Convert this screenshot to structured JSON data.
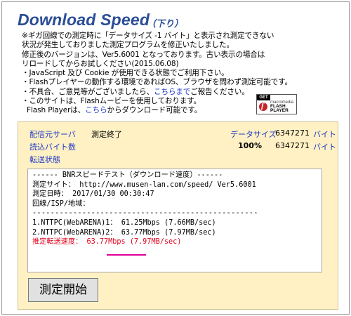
{
  "header": {
    "title": "Download Speed",
    "subtitle": "（下り）"
  },
  "notice": {
    "line1": "※ギガ回線での測定時に「データサイズ -1 バイト」と表示され測定できない",
    "line2": "状況が発生しておりました測定プログラムを修正いたしました。",
    "line3": "修正後のバージョンは、Ver5.6001 となっております。古い表示の場合は",
    "line4": "リロードしてからお試しください(2015.06.08)",
    "line5": "・JavaScript 及び Cookie が使用できる状態でご利用下さい。",
    "line6": "・Flashプレイヤーの動作する環境であればOS、ブラウザを問わず測定可能です。",
    "line7_pre": "・不具合、ご意見等がございましたら、",
    "line7_link": "こちらまで",
    "line7_post": "ご報告ください。",
    "line8": "・このサイトは、Flashムービーを使用しております。",
    "line9_pre": "Flash Playerは、",
    "line9_link": "こちら",
    "line9_post": "からダウンロード可能です。"
  },
  "flash_badge": {
    "get": "GET",
    "brand": "macromedia",
    "product_line1": "FLASH",
    "product_line2": "PLAYER",
    "icon": "flash-logo-icon"
  },
  "status": {
    "server_label": "配信元サーバ",
    "server_value": "測定終了",
    "datasize_label": "データサイズ",
    "datasize_value": "6347271",
    "datasize_unit": "バイト",
    "read_label": "読込バイト数",
    "read_percent": "100%",
    "read_value": "6347271",
    "read_unit": "バイト",
    "transfer_label": "転送状態"
  },
  "result": {
    "line1": "------ BNRスピードテスト（ダウンロード速度）------",
    "line2": "測定サイト： http://www.musen-lan.com/speed/ Ver5.6001",
    "line3": "測定日時： 2017/01/30 00:30:47",
    "line4": "回線/ISP/地域：",
    "line5": "--------------------------------------------------",
    "line6": "1.NTTPC(WebARENA)1： 61.25Mbps (7.66MB/sec)",
    "line7": "2.NTTPC(WebARENA)2： 63.77Mbps (7.97MB/sec)",
    "line8": "推定転送速度： 63.77Mbps (7.97MB/sec)"
  },
  "controls": {
    "start_label": "測定開始"
  },
  "colors": {
    "title": "#2a4d97",
    "link": "#1b36c8",
    "panel_bg": "#fff1c4",
    "result_highlight": "#e0001b"
  }
}
